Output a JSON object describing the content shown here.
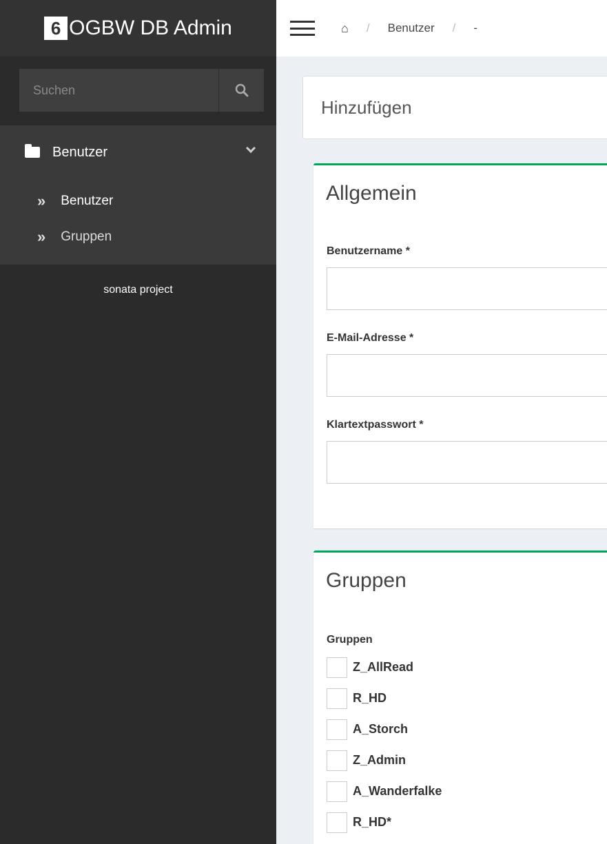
{
  "app": {
    "title": "OGBW DB Admin",
    "logo_glyph": "6"
  },
  "search": {
    "placeholder": "Suchen"
  },
  "menu": {
    "section_label": "Benutzer",
    "items": [
      {
        "label": "Benutzer",
        "active": true
      },
      {
        "label": "Gruppen",
        "active": false
      }
    ]
  },
  "footer": {
    "brand": "sonata project"
  },
  "breadcrumb": {
    "home": "⌂",
    "sep": "/",
    "section": "Benutzer",
    "current": "-"
  },
  "page": {
    "title": "Hinzufügen"
  },
  "general_box": {
    "title": "Allgemein",
    "fields": {
      "username": {
        "label": "Benutzername *",
        "value": ""
      },
      "email": {
        "label": "E-Mail-Adresse *",
        "value": ""
      },
      "password": {
        "label": "Klartextpasswort *",
        "value": ""
      }
    }
  },
  "groups_box": {
    "title": "Gruppen",
    "label": "Gruppen",
    "options": [
      {
        "label": "Z_AllRead",
        "checked": false
      },
      {
        "label": "R_HD",
        "checked": false
      },
      {
        "label": "A_Storch",
        "checked": false
      },
      {
        "label": "Z_Admin",
        "checked": false
      },
      {
        "label": "A_Wanderfalke",
        "checked": false
      },
      {
        "label": "R_HD*",
        "checked": false
      }
    ]
  },
  "colors": {
    "sidebar_bg": "#2b2b2b",
    "box_accent": "#00a65a",
    "content_bg": "#ecf0f5"
  }
}
